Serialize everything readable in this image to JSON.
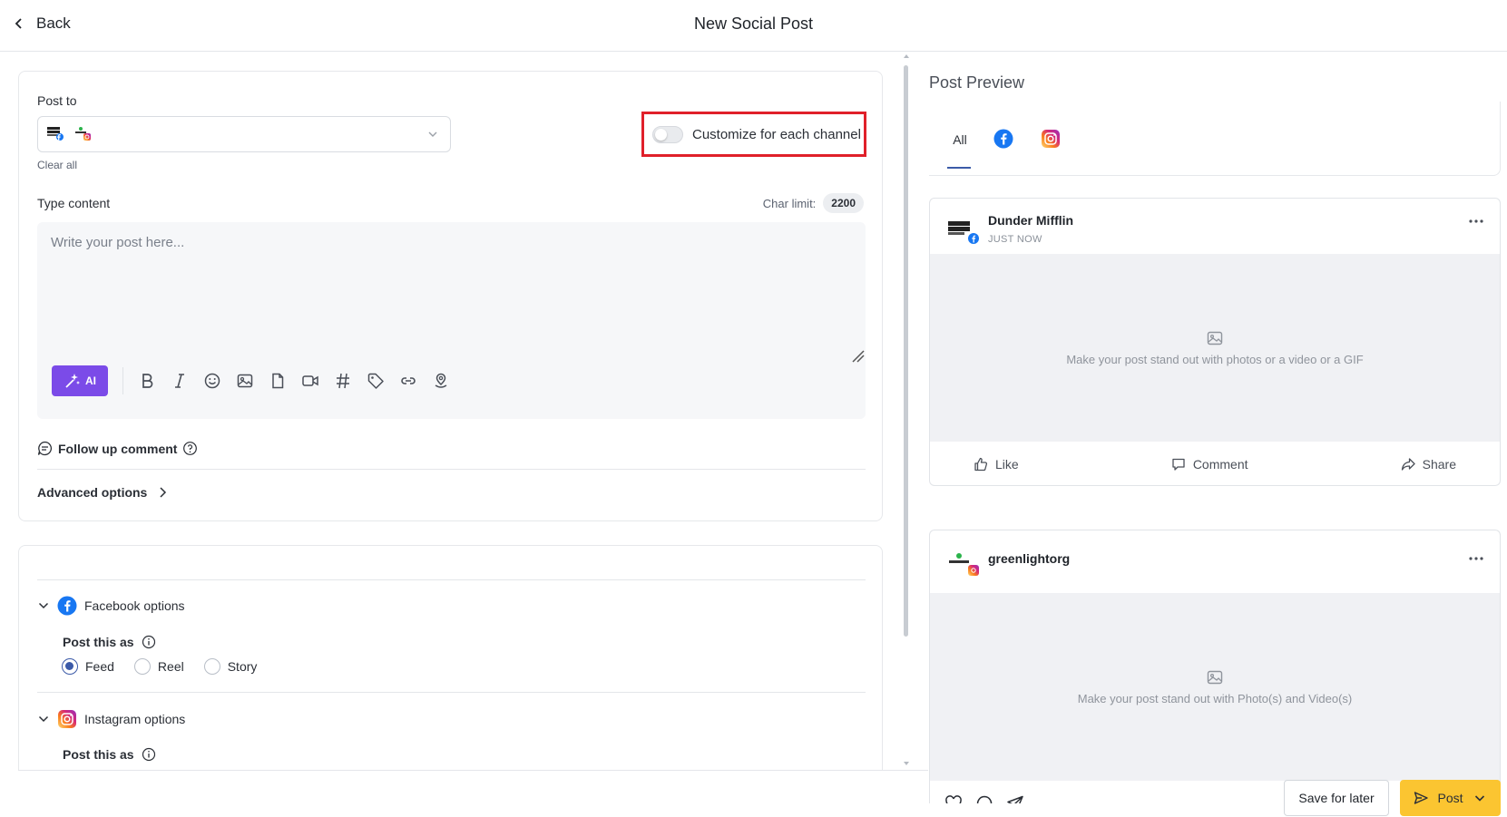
{
  "header": {
    "back_label": "Back",
    "title": "New Social Post"
  },
  "composer": {
    "post_to_label": "Post to",
    "clear_all_label": "Clear all",
    "customize_label": "Customize for each channel",
    "customize_enabled": false,
    "type_content_label": "Type content",
    "char_limit_label": "Char limit:",
    "char_limit_value": "2200",
    "content_placeholder": "Write your post here...",
    "ai_label": "AI",
    "toolbar_icons": [
      "bold-icon",
      "italic-icon",
      "emoji-icon",
      "image-icon",
      "document-icon",
      "video-icon",
      "hashtag-icon",
      "tag-icon",
      "link-icon",
      "location-icon"
    ],
    "follow_up_label": "Follow up comment",
    "advanced_label": "Advanced options"
  },
  "channel_options": {
    "facebook": {
      "title": "Facebook options",
      "post_as_label": "Post this as",
      "options": [
        "Feed",
        "Reel",
        "Story"
      ],
      "selected": "Feed"
    },
    "instagram": {
      "title": "Instagram options",
      "post_as_label": "Post this as"
    }
  },
  "preview": {
    "title": "Post Preview",
    "tabs": [
      "All",
      "facebook-icon",
      "instagram-icon"
    ],
    "active_tab": "All",
    "facebook_card": {
      "name": "Dunder Mifflin",
      "time": "JUST NOW",
      "media_hint": "Make your post stand out with photos or a video or a GIF",
      "actions": [
        "Like",
        "Comment",
        "Share"
      ]
    },
    "instagram_card": {
      "name": "greenlightorg",
      "media_hint": "Make your post stand out with Photo(s) and Video(s)"
    }
  },
  "footer": {
    "save_label": "Save for later",
    "post_label": "Post"
  },
  "colors": {
    "ai_purple": "#7b4be8",
    "post_yellow": "#fbc531",
    "highlight_red": "#e0202a",
    "radio_blue": "#3b5aa8",
    "facebook_blue": "#1877f2"
  }
}
